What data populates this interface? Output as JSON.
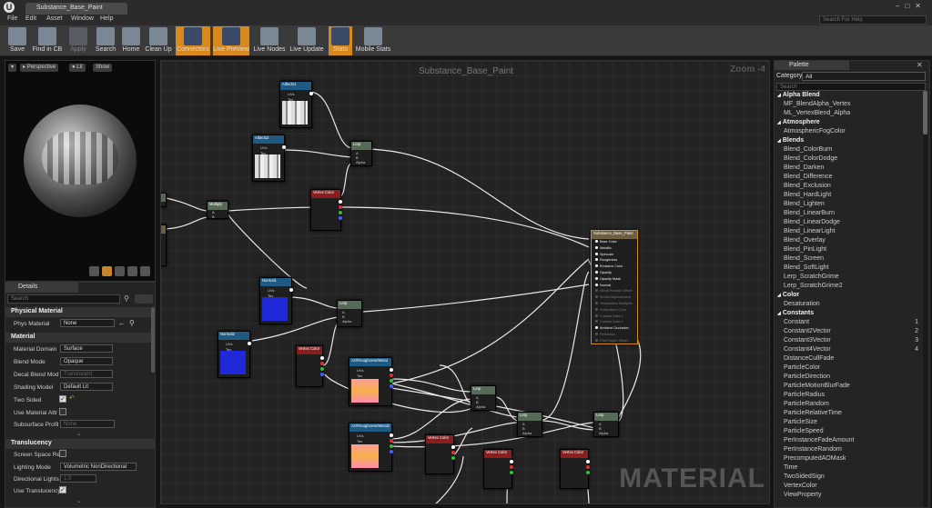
{
  "window": {
    "tab_title": "Substance_Base_Paint",
    "search_help": "Search For Help"
  },
  "menu": [
    "File",
    "Edit",
    "Asset",
    "Window",
    "Help"
  ],
  "toolbar": [
    {
      "label": "Save",
      "icon": "save-icon",
      "active": false
    },
    {
      "label": "Find in CB",
      "icon": "find-in-cb-icon",
      "active": false
    },
    {
      "label": "Apply",
      "icon": "apply-icon",
      "active": false
    },
    {
      "label": "Search",
      "icon": "search-icon",
      "active": false
    },
    {
      "label": "Home",
      "icon": "home-icon",
      "active": false
    },
    {
      "label": "Clean Up",
      "icon": "clean-up-icon",
      "active": false
    },
    {
      "label": "Connectors",
      "icon": "connectors-icon",
      "active": true
    },
    {
      "label": "Live Preview",
      "icon": "live-preview-icon",
      "active": true
    },
    {
      "label": "Live Nodes",
      "icon": "live-nodes-icon",
      "active": false
    },
    {
      "label": "Live Update",
      "icon": "live-update-icon",
      "active": false
    },
    {
      "label": "Stats",
      "icon": "stats-icon",
      "active": true
    },
    {
      "label": "Mobile Stats",
      "icon": "mobile-stats-icon",
      "active": false
    }
  ],
  "viewport": {
    "perspective": "Perspective",
    "lit": "Lit",
    "show": "Show"
  },
  "details": {
    "tab": "Details",
    "search_placeholder": "Search",
    "sections": {
      "physical": "Physical Material",
      "material": "Material",
      "translucency": "Translucency"
    },
    "phys_material": {
      "label": "Phys Material",
      "value": "None"
    },
    "material_domain": {
      "label": "Material Domain",
      "value": "Surface"
    },
    "blend_mode": {
      "label": "Blend Mode",
      "value": "Opaque"
    },
    "decal_blend": {
      "label": "Decal Blend Mod",
      "value": "Translucent"
    },
    "shading_model": {
      "label": "Shading Model",
      "value": "Default Lit"
    },
    "two_sided": {
      "label": "Two Sided",
      "checked": true
    },
    "use_material_attr": {
      "label": "Use Material Attr",
      "checked": false
    },
    "subsurface": {
      "label": "Subsurface Profil",
      "value": "None"
    },
    "screen_space": {
      "label": "Screen Space Re",
      "checked": false
    },
    "lighting_mode": {
      "label": "Lighting Mode",
      "value": "Volumetric NonDirectional"
    },
    "directional_lights": {
      "label": "Directional Lights",
      "value": "1.0"
    },
    "use_translucency": {
      "label": "Use Translucency",
      "checked": true
    }
  },
  "graph": {
    "title": "Substance_Base_Paint",
    "zoom": "Zoom -4",
    "watermark": "MATERIAL",
    "labels": {
      "albedo1": "Albedo1",
      "albedo2": "Albedo2",
      "normal1": "Normal1",
      "normal2": "Normal2",
      "ao1": "AO/Roughness/Metal",
      "ao2": "AO/Roughness/Metal2",
      "lerp": "Lerp",
      "vertex": "Vertex Color",
      "multiply": "Multiply",
      "output": "Substance_Base_Paint",
      "uvs": "UVs",
      "tex": "Tex",
      "a": "A",
      "b": "B",
      "alpha": "Alpha"
    },
    "output_pins": [
      "Base Color",
      "Metallic",
      "Specular",
      "Roughness",
      "Emissive Color",
      "Opacity",
      "Opacity Mask",
      "Normal",
      "World Position Offset",
      "World Displacement",
      "Tessellation Multiplier",
      "Subsurface Color",
      "Custom Data 0",
      "Custom Data 1",
      "Ambient Occlusion",
      "Refraction",
      "Pixel Depth Offset"
    ]
  },
  "palette": {
    "tab": "Palette",
    "category_label": "Category",
    "category_value": "All",
    "search_placeholder": "Search",
    "items": [
      {
        "t": "Alpha Blend",
        "cat": true
      },
      {
        "t": "MF_BlendAlpha_Vertex"
      },
      {
        "t": "ML_VertexBlend_Alpha"
      },
      {
        "t": "Atmosphere",
        "cat": true
      },
      {
        "t": "AtmosphericFogColor"
      },
      {
        "t": "Blends",
        "cat": true
      },
      {
        "t": "Blend_ColorBurn"
      },
      {
        "t": "Blend_ColorDodge"
      },
      {
        "t": "Blend_Darken"
      },
      {
        "t": "Blend_Difference"
      },
      {
        "t": "Blend_Exclusion"
      },
      {
        "t": "Blend_HardLight"
      },
      {
        "t": "Blend_Lighten"
      },
      {
        "t": "Blend_LinearBurn"
      },
      {
        "t": "Blend_LinearDodge"
      },
      {
        "t": "Blend_LinearLight"
      },
      {
        "t": "Blend_Overlay"
      },
      {
        "t": "Blend_PinLight"
      },
      {
        "t": "Blend_Screen"
      },
      {
        "t": "Blend_SoftLight"
      },
      {
        "t": "Lerp_ScratchGrime"
      },
      {
        "t": "Lerp_ScratchGrime2"
      },
      {
        "t": "Color",
        "cat": true
      },
      {
        "t": "Desaturation"
      },
      {
        "t": "Constants",
        "cat": true
      },
      {
        "t": "Constant",
        "key": "1"
      },
      {
        "t": "Constant2Vector",
        "key": "2"
      },
      {
        "t": "Constant3Vector",
        "key": "3"
      },
      {
        "t": "Constant4Vector",
        "key": "4"
      },
      {
        "t": "DistanceCullFade"
      },
      {
        "t": "ParticleColor"
      },
      {
        "t": "ParticleDirection"
      },
      {
        "t": "ParticleMotionBlurFade"
      },
      {
        "t": "ParticleRadius"
      },
      {
        "t": "ParticleRandom"
      },
      {
        "t": "ParticleRelativeTime"
      },
      {
        "t": "ParticleSize"
      },
      {
        "t": "ParticleSpeed"
      },
      {
        "t": "PerInstanceFadeAmount"
      },
      {
        "t": "PerInstanceRandom"
      },
      {
        "t": "PrecomputedAOMask"
      },
      {
        "t": "Time"
      },
      {
        "t": "TwoSidedSign"
      },
      {
        "t": "VertexColor"
      },
      {
        "t": "ViewProperty"
      }
    ]
  },
  "colors": {
    "accent": "#d8891e",
    "texture_header": "#1f5a82",
    "math_header": "#556b58",
    "vector_header": "#8a1d1d",
    "graph_bg": "#232323"
  }
}
